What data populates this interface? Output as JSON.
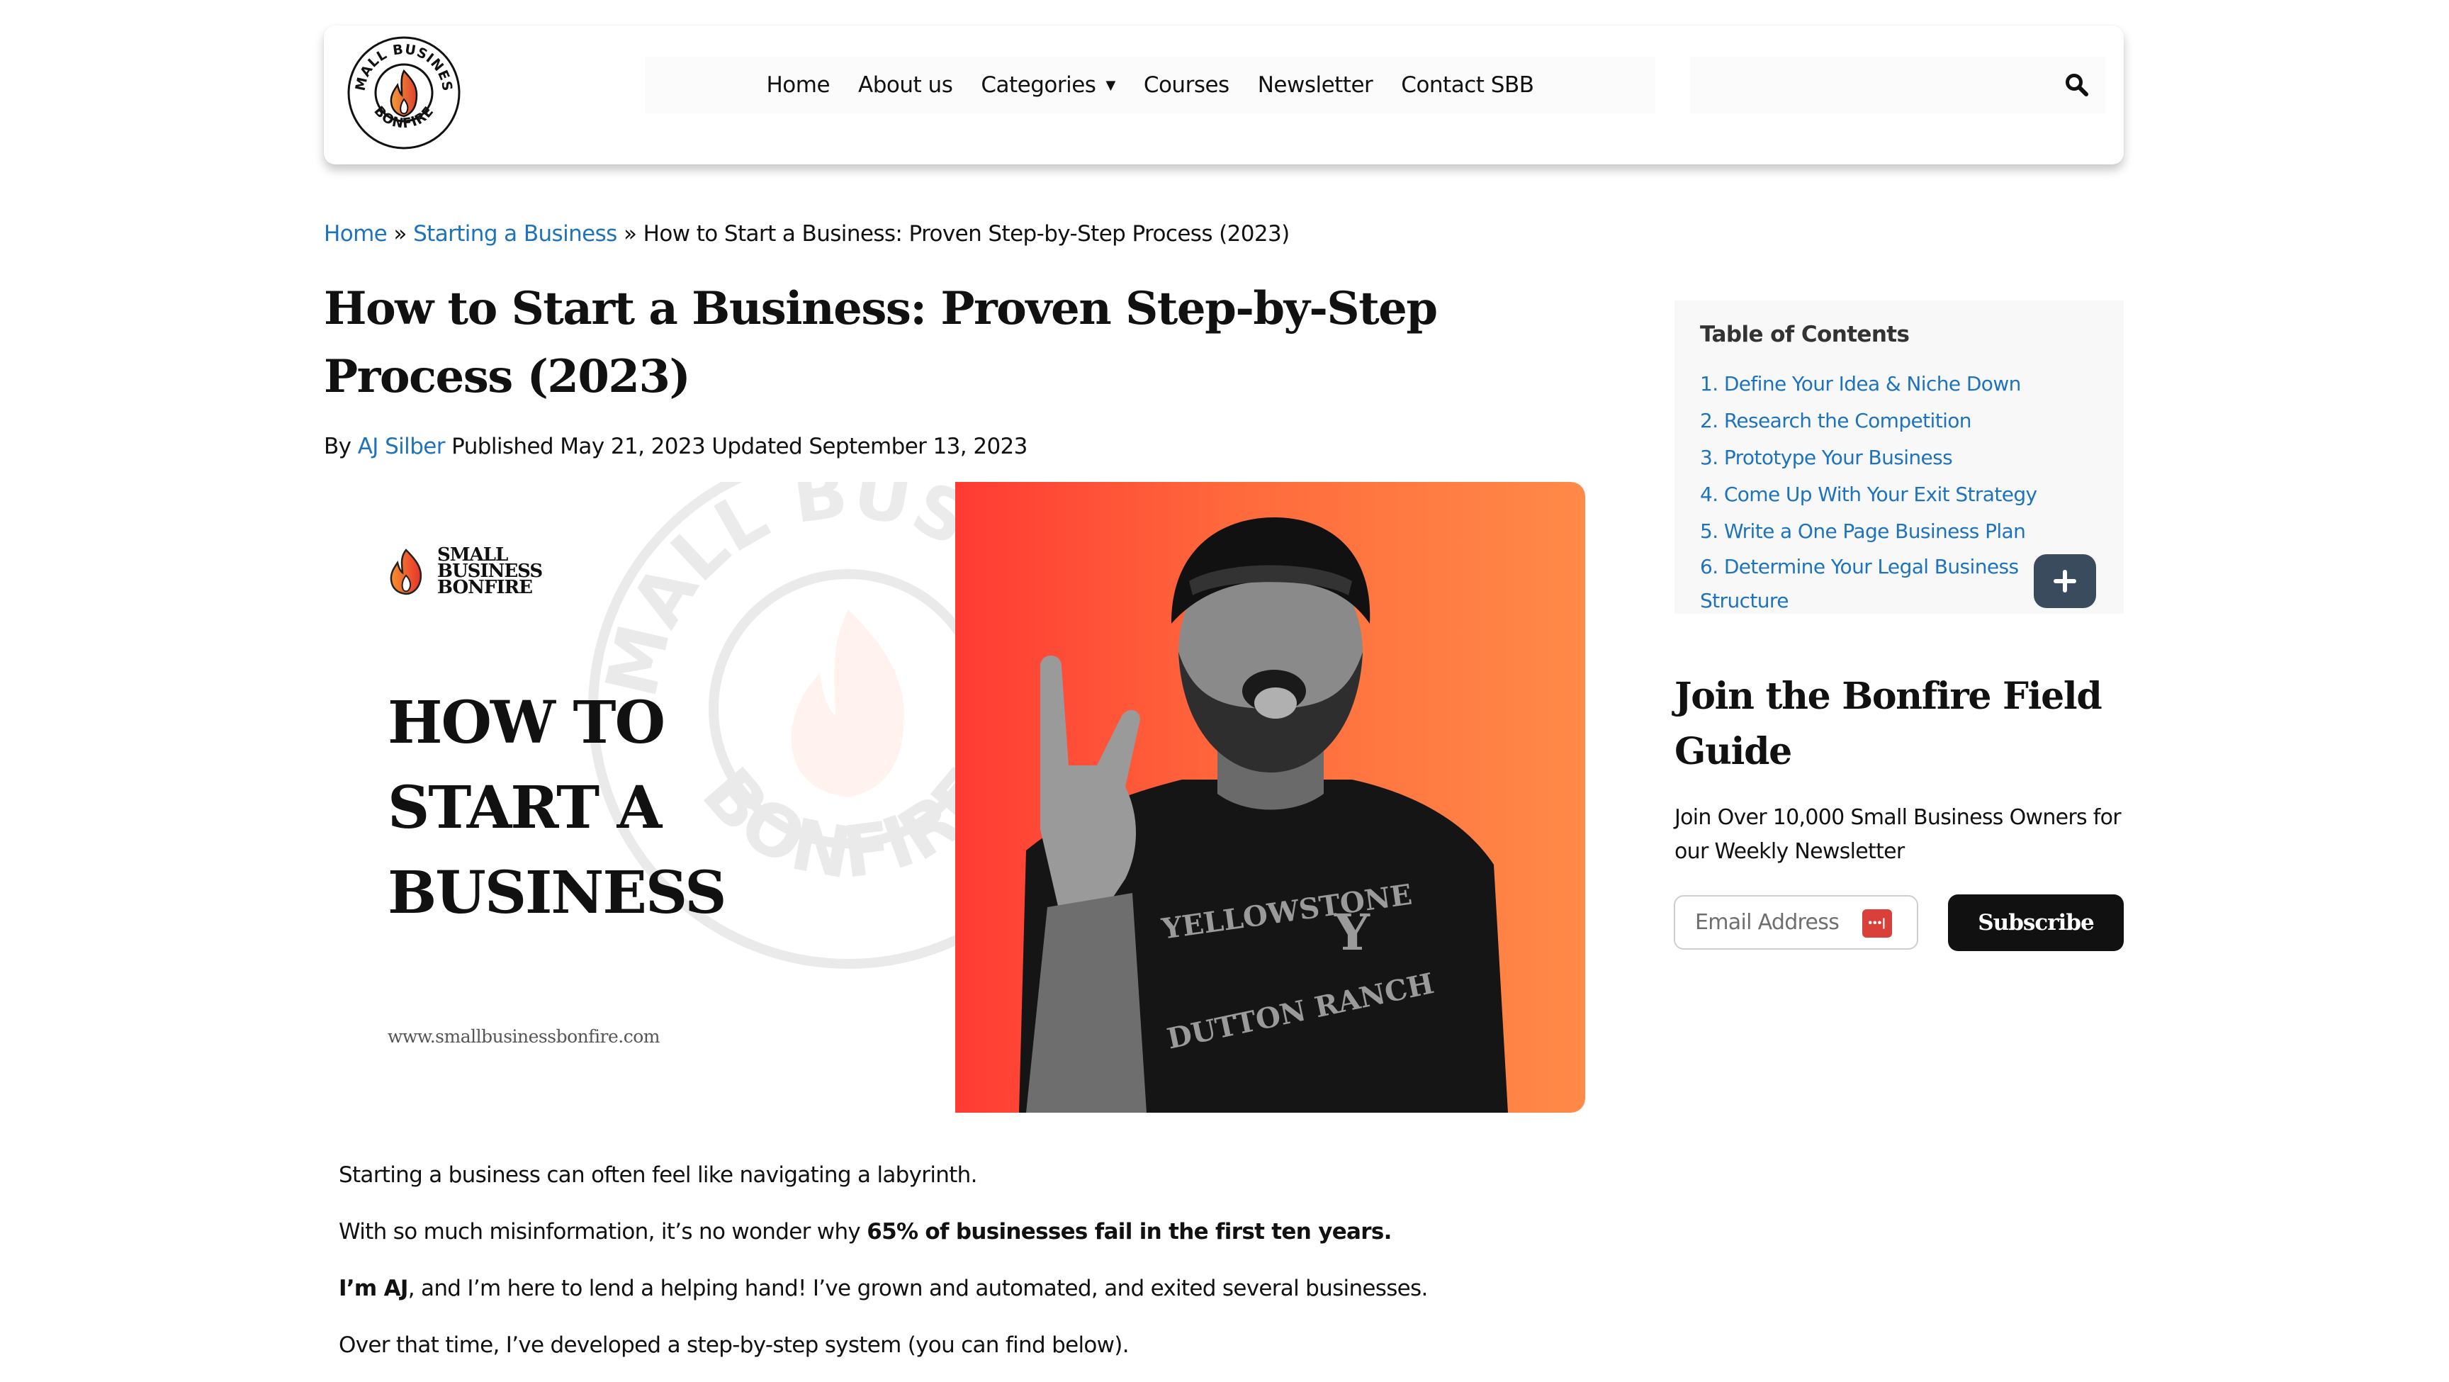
{
  "brand": {
    "logo_top_text": "SMALL BUSINESS",
    "logo_bottom_text": "BONFIRE",
    "accent_color": "#1e73be"
  },
  "nav": {
    "items": [
      {
        "label": "Home"
      },
      {
        "label": "About us"
      },
      {
        "label": "Categories",
        "has_dropdown": true
      },
      {
        "label": "Courses"
      },
      {
        "label": "Newsletter"
      },
      {
        "label": "Contact SBB"
      }
    ],
    "search_icon": "search-icon"
  },
  "breadcrumb": {
    "items": [
      "Home",
      "Starting a Business"
    ],
    "separator": "»",
    "current": "How to Start a Business: Proven Step-by-Step Process (2023)"
  },
  "article": {
    "title": "How to Start a Business: Proven Step-by-Step Process (2023)",
    "byline_prefix": "By",
    "author": "AJ Silber",
    "published_label": "Published",
    "published_date": "May 21, 2023",
    "updated_label": "Updated",
    "updated_date": "September 13, 2023",
    "hero": {
      "mini_logo_lines": [
        "SMALL",
        "BUSINESS",
        "BONFIRE"
      ],
      "headline": "HOW TO\nSTART A\nBUSINESS",
      "url": "www.smallbusinessbonfire.com",
      "watermark_top": "SMALL BUSINESS",
      "watermark_bottom": "BONFIRE",
      "shirt_line1": "YELLOWSTONE",
      "shirt_line2": "DUTTON RANCH",
      "gradient_start": "#ff3a33",
      "gradient_end": "#ff8a48"
    },
    "paragraphs": [
      {
        "text": "Starting a business can often feel like navigating a labyrinth."
      },
      {
        "pre": "With so much misinformation, it’s no wonder why ",
        "bold": "65% of businesses fail in the first ten years.",
        "post": ""
      },
      {
        "bold_first": "I’m AJ",
        "post": ", and I’m here to lend a helping hand! I’ve grown and automated, and exited several businesses."
      },
      {
        "text": "Over that time, I’ve developed a step-by-step system (you can find below)."
      }
    ]
  },
  "toc": {
    "title": "Table of Contents",
    "items": [
      "1. Define Your Idea & Niche Down",
      "2. Research the Competition",
      "3. Prototype Your Business",
      "4. Come Up With Your Exit Strategy",
      "5. Write a One Page Business Plan",
      "6. Determine Your Legal Business Structure"
    ],
    "expand_label": "+"
  },
  "newsletter": {
    "title": "Join the Bonfire Field Guide",
    "description": "Join Over 10,000 Small Business Owners for our Weekly Newsletter",
    "email_placeholder": "Email Address",
    "email_value": "",
    "subscribe_label": "Subscribe"
  }
}
